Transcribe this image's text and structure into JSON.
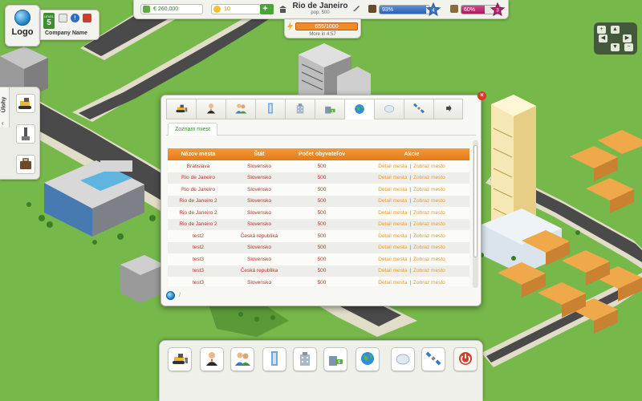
{
  "game": {
    "logo_text": "Logo",
    "level_label": "LEVEL",
    "level": "5",
    "company_name": "Company Name"
  },
  "top_bar": {
    "money": "€ 260,000",
    "coins": "10",
    "plus_symbol": "+",
    "city_name": "Rio de Janeiro",
    "population": "pop. 500",
    "health_percent": "93%",
    "health_stars": "4",
    "happiness_percent": "60%",
    "happiness_stars": "3",
    "energy": "655/1000",
    "energy_more": "More in 4:57"
  },
  "bars": {
    "health_fill": 0.93,
    "happiness_fill": 0.6,
    "energy_fill": 0.655
  },
  "side_panel": {
    "tab_label": "Úlohy",
    "collapse_symbol": "‹"
  },
  "nav": {
    "up": "▲",
    "down": "▼",
    "left": "◀",
    "right": "▶",
    "zoom_in": "+",
    "zoom_out": "−"
  },
  "modal": {
    "close_symbol": "×",
    "subtab_label": "Zoznam miest",
    "tabs": [
      "bulldozer-icon",
      "businessman-icon",
      "people-icon",
      "skyscraper-icon",
      "office-building-icon",
      "money-building-icon",
      "globe-icon",
      "cloud-icon",
      "satellite-icon",
      "arrow-icon"
    ],
    "active_tab": 6,
    "footer_sep": "/",
    "columns": [
      "Názov mesta",
      "Štát",
      "Počet obyvateľov",
      "Akcie"
    ],
    "action_detail": "Detail mesta",
    "action_sep": "|",
    "action_show": "Zobraz mesto",
    "rows": [
      {
        "city": "Bratislava",
        "country": "Slovensko",
        "population": "500"
      },
      {
        "city": "Rio de Janeiro",
        "country": "Slovensko",
        "population": "500"
      },
      {
        "city": "Rio de Janeiro",
        "country": "Slovensko",
        "population": "500"
      },
      {
        "city": "Rio de Janeiro 2",
        "country": "Slovensko",
        "population": "500"
      },
      {
        "city": "Rio de Janeiro 2",
        "country": "Slovensko",
        "population": "500"
      },
      {
        "city": "Rio de Janeiro 2",
        "country": "Slovensko",
        "population": "500"
      },
      {
        "city": "test2",
        "country": "Česká republika",
        "population": "500"
      },
      {
        "city": "test2",
        "country": "Slovensko",
        "population": "500"
      },
      {
        "city": "test3",
        "country": "Slovensko",
        "population": "500"
      },
      {
        "city": "test3",
        "country": "Česká republika",
        "population": "500"
      },
      {
        "city": "test3",
        "country": "Slovensko",
        "population": "500"
      }
    ]
  },
  "toolbar": [
    "bulldozer-icon",
    "businessman-icon",
    "people-icon",
    "skyscraper-icon",
    "office-building-icon",
    "money-building-icon",
    "globe-icon",
    "cloud-icon",
    "satellite-icon",
    "power-icon"
  ],
  "colors": {
    "grass": "#77b84a",
    "road": "#4a4a4a",
    "accent_orange": "#e88a28",
    "accent_green": "#45a636",
    "health_blue": "#3b74c9",
    "happiness_pink": "#b8216e",
    "link_orange": "#f09a2c",
    "row_text_red": "#b5372b"
  }
}
